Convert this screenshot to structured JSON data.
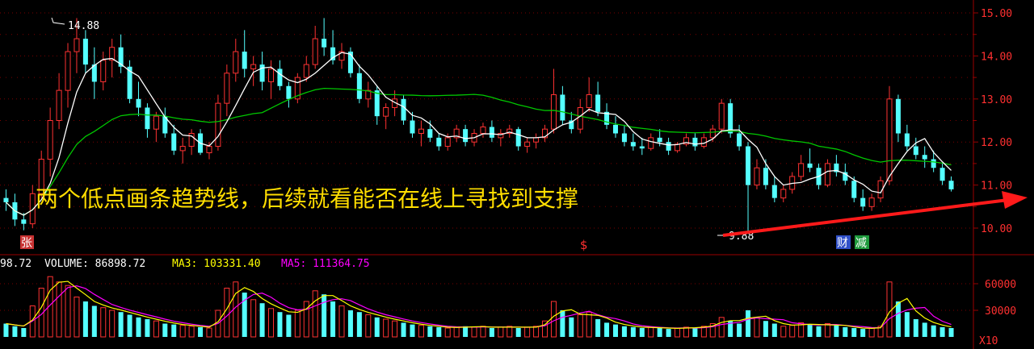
{
  "price_panel": {
    "high_marker": "14.88",
    "low_marker": "9.88",
    "y_ticks": [
      "15.00",
      "14.00",
      "13.00",
      "12.00",
      "11.00",
      "10.00"
    ],
    "annotation": "两个低点画条趋势线，后续就看能否在线上寻找到支撑",
    "tags": {
      "zhang": "张",
      "dollar": "$",
      "cai": "财",
      "jian": "减"
    }
  },
  "volume_panel": {
    "header_first": "98.72",
    "volume_label": "VOLUME: 86898.72",
    "ma3_label": "MA3: 103331.40",
    "ma5_label": "MA5: 111364.75",
    "y_ticks": [
      "60000",
      "30000"
    ],
    "unit": "X10"
  },
  "colors": {
    "up": "#ff3232",
    "down": "#54ffff",
    "ma_short": "#ffffff",
    "ma_long": "#00c800",
    "grid": "#7a0000",
    "axis_text": "#ff3030",
    "annotation_text": "#ffdd00",
    "trendline": "#ff1a1a",
    "vol_ma3": "#ffff00",
    "vol_ma5": "#ff00ff"
  },
  "chart_data": [
    {
      "type": "candlestick",
      "ylim": [
        9.75,
        15.15
      ],
      "grid": true,
      "y_ticks": [
        15.0,
        14.0,
        13.0,
        12.0,
        11.0,
        10.0
      ],
      "values": [
        [
          10.7,
          10.9,
          10.4,
          10.6
        ],
        [
          10.6,
          10.8,
          10.05,
          10.2
        ],
        [
          10.2,
          10.35,
          9.95,
          10.1
        ],
        [
          10.1,
          11.0,
          10.0,
          10.8
        ],
        [
          10.8,
          11.8,
          10.7,
          11.6
        ],
        [
          11.6,
          12.8,
          11.2,
          12.5
        ],
        [
          12.5,
          13.6,
          12.3,
          13.2
        ],
        [
          13.2,
          14.3,
          12.8,
          14.1
        ],
        [
          14.1,
          14.88,
          13.6,
          14.4
        ],
        [
          14.4,
          14.6,
          13.6,
          13.8
        ],
        [
          13.8,
          14.2,
          13.0,
          13.4
        ],
        [
          13.4,
          14.1,
          13.2,
          13.9
        ],
        [
          13.9,
          14.4,
          13.5,
          14.2
        ],
        [
          14.2,
          14.5,
          13.6,
          13.75
        ],
        [
          13.75,
          13.9,
          12.9,
          13.0
        ],
        [
          13.0,
          13.4,
          12.6,
          12.8
        ],
        [
          12.8,
          12.9,
          12.1,
          12.3
        ],
        [
          12.3,
          12.7,
          12.0,
          12.6
        ],
        [
          12.6,
          12.8,
          12.1,
          12.2
        ],
        [
          12.2,
          12.4,
          11.7,
          11.8
        ],
        [
          11.8,
          12.1,
          11.5,
          11.9
        ],
        [
          11.9,
          12.3,
          11.7,
          12.2
        ],
        [
          12.2,
          12.3,
          11.7,
          11.75
        ],
        [
          11.75,
          12.0,
          11.6,
          11.9
        ],
        [
          11.9,
          13.1,
          11.8,
          12.9
        ],
        [
          12.9,
          13.8,
          12.6,
          13.6
        ],
        [
          13.6,
          14.4,
          13.4,
          14.1
        ],
        [
          14.1,
          14.6,
          13.5,
          13.7
        ],
        [
          13.7,
          14.0,
          13.3,
          13.8
        ],
        [
          13.8,
          14.1,
          13.2,
          13.4
        ],
        [
          13.4,
          13.9,
          13.0,
          13.7
        ],
        [
          13.7,
          13.9,
          13.2,
          13.3
        ],
        [
          13.3,
          13.4,
          12.8,
          13.0
        ],
        [
          13.0,
          13.6,
          12.9,
          13.5
        ],
        [
          13.5,
          14.0,
          13.4,
          13.8
        ],
        [
          13.8,
          14.7,
          13.7,
          14.4
        ],
        [
          14.4,
          14.88,
          14.0,
          14.2
        ],
        [
          14.2,
          14.6,
          13.8,
          13.9
        ],
        [
          13.9,
          14.3,
          13.7,
          14.1
        ],
        [
          14.1,
          14.2,
          13.5,
          13.6
        ],
        [
          13.6,
          13.8,
          12.9,
          13.0
        ],
        [
          13.0,
          13.4,
          12.8,
          13.2
        ],
        [
          13.2,
          13.3,
          12.4,
          12.6
        ],
        [
          12.6,
          12.9,
          12.3,
          12.8
        ],
        [
          12.8,
          13.2,
          12.6,
          13.0
        ],
        [
          13.0,
          13.1,
          12.4,
          12.5
        ],
        [
          12.5,
          12.7,
          12.1,
          12.2
        ],
        [
          12.2,
          12.5,
          11.9,
          12.3
        ],
        [
          12.3,
          12.5,
          12.0,
          12.1
        ],
        [
          12.1,
          12.2,
          11.8,
          11.9
        ],
        [
          11.9,
          12.2,
          11.8,
          12.1
        ],
        [
          12.1,
          12.4,
          12.0,
          12.3
        ],
        [
          12.3,
          12.4,
          11.9,
          12.0
        ],
        [
          12.0,
          12.3,
          11.9,
          12.2
        ],
        [
          12.2,
          12.45,
          12.1,
          12.35
        ],
        [
          12.35,
          12.5,
          12.0,
          12.1
        ],
        [
          12.1,
          12.3,
          11.9,
          12.2
        ],
        [
          12.2,
          12.4,
          12.1,
          12.3
        ],
        [
          12.3,
          12.35,
          11.8,
          11.9
        ],
        [
          11.9,
          12.1,
          11.75,
          12.0
        ],
        [
          12.0,
          12.2,
          11.85,
          12.1
        ],
        [
          12.1,
          12.4,
          12.0,
          12.3
        ],
        [
          12.3,
          13.7,
          12.2,
          13.1
        ],
        [
          13.1,
          13.3,
          12.4,
          12.5
        ],
        [
          12.5,
          12.7,
          12.2,
          12.3
        ],
        [
          12.3,
          13.0,
          12.2,
          12.8
        ],
        [
          12.8,
          13.5,
          12.7,
          13.1
        ],
        [
          13.1,
          13.4,
          12.6,
          12.7
        ],
        [
          12.7,
          12.9,
          12.3,
          12.4
        ],
        [
          12.4,
          12.6,
          12.1,
          12.2
        ],
        [
          12.2,
          12.4,
          11.9,
          12.0
        ],
        [
          12.0,
          12.2,
          11.8,
          11.9
        ],
        [
          11.9,
          12.1,
          11.7,
          11.85
        ],
        [
          11.85,
          12.2,
          11.8,
          12.1
        ],
        [
          12.1,
          12.3,
          11.9,
          12.0
        ],
        [
          12.0,
          12.1,
          11.7,
          11.8
        ],
        [
          11.8,
          12.0,
          11.75,
          11.95
        ],
        [
          11.95,
          12.2,
          11.9,
          12.1
        ],
        [
          12.1,
          12.2,
          11.8,
          11.9
        ],
        [
          11.9,
          12.2,
          11.85,
          12.1
        ],
        [
          12.1,
          12.4,
          12.0,
          12.3
        ],
        [
          12.3,
          13.0,
          12.2,
          12.9
        ],
        [
          12.9,
          13.0,
          12.1,
          12.2
        ],
        [
          12.2,
          12.4,
          11.8,
          11.9
        ],
        [
          11.9,
          12.0,
          9.88,
          11.0
        ],
        [
          11.0,
          11.6,
          10.9,
          11.4
        ],
        [
          11.4,
          11.6,
          10.9,
          11.0
        ],
        [
          11.0,
          11.2,
          10.6,
          10.7
        ],
        [
          10.7,
          11.0,
          10.6,
          10.9
        ],
        [
          10.9,
          11.3,
          10.8,
          11.2
        ],
        [
          11.2,
          11.7,
          11.1,
          11.5
        ],
        [
          11.5,
          11.85,
          11.3,
          11.4
        ],
        [
          11.4,
          11.5,
          10.9,
          11.0
        ],
        [
          11.0,
          11.6,
          10.95,
          11.5
        ],
        [
          11.5,
          11.7,
          11.2,
          11.3
        ],
        [
          11.3,
          11.5,
          11.0,
          11.1
        ],
        [
          11.1,
          11.2,
          10.6,
          10.7
        ],
        [
          10.7,
          10.9,
          10.4,
          10.5
        ],
        [
          10.5,
          10.8,
          10.4,
          10.7
        ],
        [
          10.7,
          11.2,
          10.6,
          11.1
        ],
        [
          11.1,
          13.3,
          11.0,
          13.0
        ],
        [
          13.0,
          13.1,
          12.0,
          12.2
        ],
        [
          12.2,
          12.4,
          11.8,
          11.9
        ],
        [
          11.9,
          12.1,
          11.6,
          11.7
        ],
        [
          11.7,
          11.9,
          11.4,
          11.6
        ],
        [
          11.6,
          11.8,
          11.3,
          11.4
        ],
        [
          11.4,
          11.5,
          11.0,
          11.1
        ],
        [
          11.1,
          11.2,
          10.85,
          10.9
        ]
      ]
    },
    {
      "type": "bar",
      "ylim": [
        0,
        75000
      ],
      "y_ticks": [
        60000,
        30000
      ],
      "values": [
        15000,
        12000,
        10000,
        35000,
        55000,
        68000,
        62000,
        58000,
        45000,
        40000,
        35000,
        33000,
        30000,
        28000,
        25000,
        22000,
        20000,
        18000,
        15000,
        14000,
        13000,
        12000,
        11000,
        10000,
        30000,
        55000,
        62000,
        50000,
        42000,
        38000,
        32000,
        28000,
        25000,
        30000,
        40000,
        52000,
        48000,
        40000,
        35000,
        30000,
        28000,
        25000,
        22000,
        20000,
        18000,
        16000,
        14000,
        13000,
        12000,
        11000,
        10000,
        11000,
        12000,
        11000,
        12000,
        10000,
        11000,
        12000,
        10000,
        11000,
        12000,
        18000,
        40000,
        30000,
        22000,
        25000,
        28000,
        20000,
        16000,
        14000,
        12000,
        11000,
        10000,
        11000,
        10000,
        9000,
        10000,
        11000,
        10000,
        12000,
        15000,
        22000,
        18000,
        15000,
        30000,
        22000,
        18000,
        15000,
        12000,
        13000,
        16000,
        14000,
        12000,
        15000,
        13000,
        11000,
        10000,
        9000,
        10000,
        12000,
        62000,
        40000,
        28000,
        20000,
        16000,
        13000,
        11000,
        10000
      ]
    }
  ]
}
